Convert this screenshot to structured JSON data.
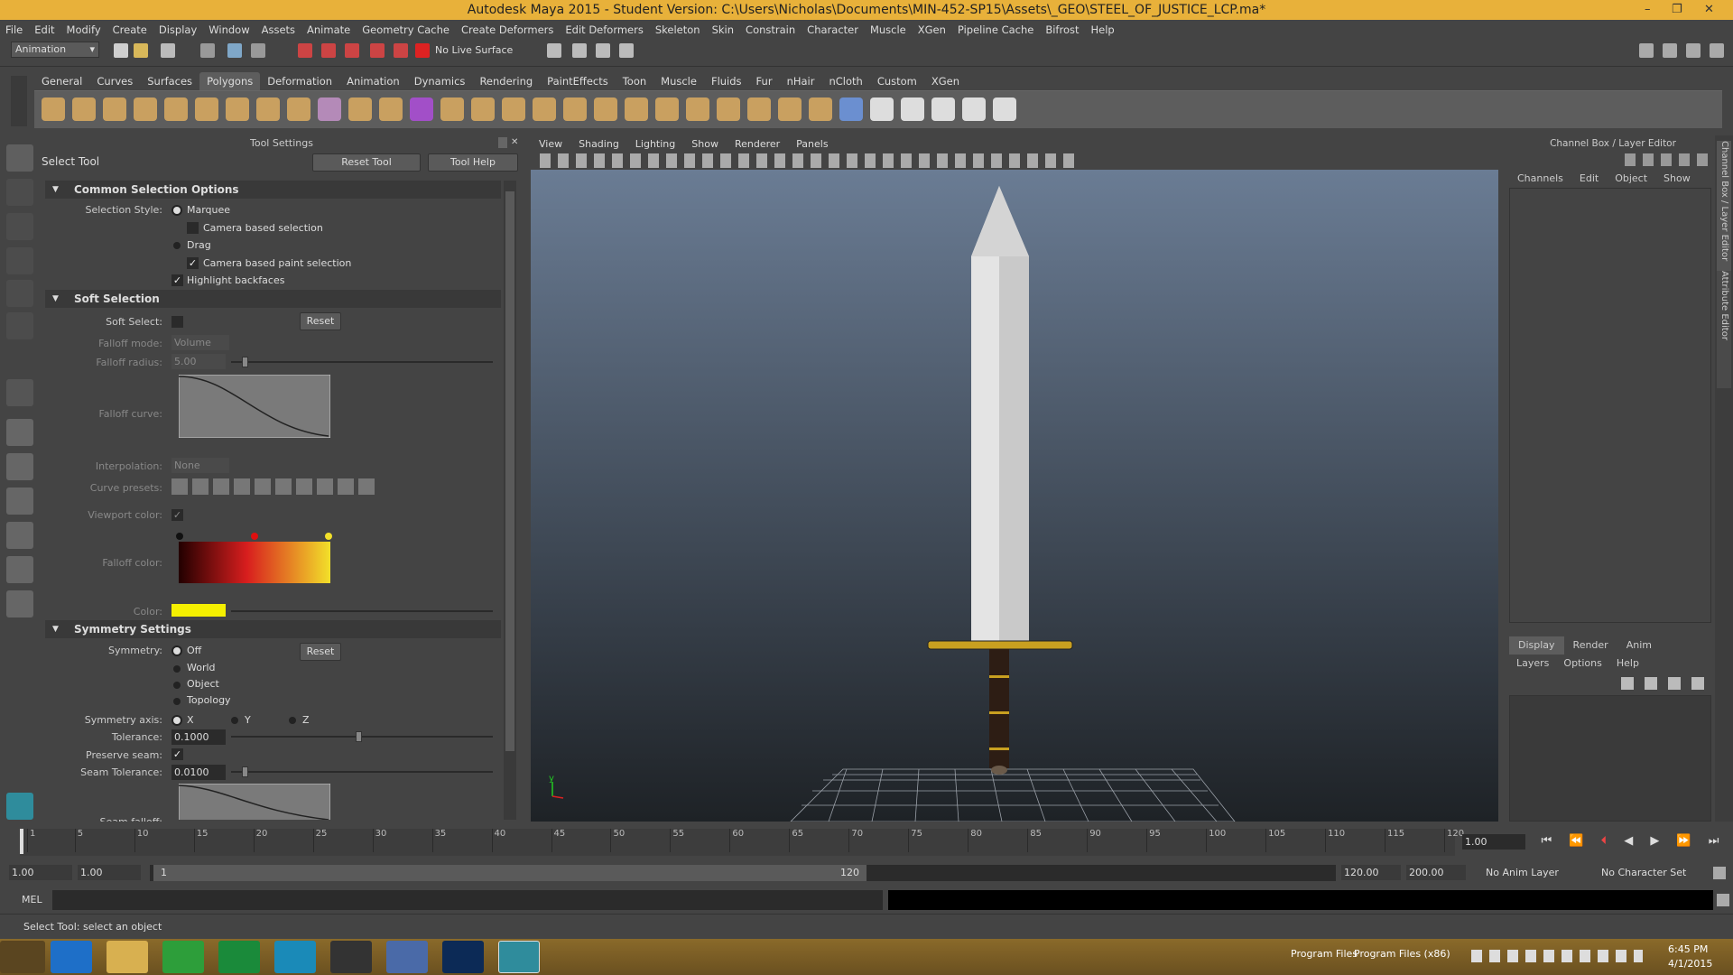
{
  "titlebar": {
    "title": "Autodesk Maya 2015 - Student Version: C:\\Users\\Nicholas\\Documents\\MIN-452-SP15\\Assets\\_GEO\\STEEL_OF_JUSTICE_LCP.ma*",
    "minimize": "–",
    "restore": "❐",
    "close": "✕"
  },
  "menubar": [
    "File",
    "Edit",
    "Modify",
    "Create",
    "Display",
    "Window",
    "Assets",
    "Animate",
    "Geometry Cache",
    "Create Deformers",
    "Edit Deformers",
    "Skeleton",
    "Skin",
    "Constrain",
    "Character",
    "Muscle",
    "XGen",
    "Pipeline Cache",
    "Bifrost",
    "Help"
  ],
  "statusline": {
    "mode": "Animation",
    "live_surface": "No Live Surface"
  },
  "shelf": {
    "tabs": [
      "General",
      "Curves",
      "Surfaces",
      "Polygons",
      "Deformation",
      "Animation",
      "Dynamics",
      "Rendering",
      "PaintEffects",
      "Toon",
      "Muscle",
      "Fluids",
      "Fur",
      "nHair",
      "nCloth",
      "Custom",
      "XGen"
    ],
    "active": "Polygons"
  },
  "tool_settings": {
    "header": "Tool Settings",
    "tool_name": "Select Tool",
    "reset_button": "Reset Tool",
    "help_button": "Tool Help",
    "common": {
      "title": "Common Selection Options",
      "style_label": "Selection Style:",
      "marquee": "Marquee",
      "camera_based": "Camera based selection",
      "drag": "Drag",
      "camera_paint": "Camera based paint selection",
      "backfaces": "Highlight backfaces"
    },
    "soft": {
      "title": "Soft Selection",
      "soft_select": "Soft Select:",
      "reset": "Reset",
      "falloff_mode": "Falloff mode:",
      "falloff_mode_val": "Volume",
      "falloff_radius": "Falloff radius:",
      "falloff_radius_val": "5.00",
      "falloff_curve": "Falloff curve:",
      "interpolation": "Interpolation:",
      "interpolation_val": "None",
      "curve_presets": "Curve presets:",
      "viewport_color": "Viewport color:",
      "falloff_color": "Falloff color:",
      "color": "Color:"
    },
    "symmetry": {
      "title": "Symmetry Settings",
      "symmetry": "Symmetry:",
      "off": "Off",
      "world": "World",
      "object": "Object",
      "topology": "Topology",
      "reset": "Reset",
      "axis": "Symmetry axis:",
      "x": "X",
      "y": "Y",
      "z": "Z",
      "tolerance": "Tolerance:",
      "tolerance_val": "0.1000",
      "preserve": "Preserve seam:",
      "seam_tol": "Seam Tolerance:",
      "seam_tol_val": "0.0100",
      "seam_falloff": "Seam falloff:"
    }
  },
  "viewport": {
    "menu": [
      "View",
      "Shading",
      "Lighting",
      "Show",
      "Renderer",
      "Panels"
    ],
    "axis_y": "y"
  },
  "channel_box": {
    "header": "Channel Box / Layer Editor",
    "menu": [
      "Channels",
      "Edit",
      "Object",
      "Show"
    ],
    "layer_tabs": [
      "Display",
      "Render",
      "Anim"
    ],
    "layer_menu": [
      "Layers",
      "Options",
      "Help"
    ],
    "side_tabs": [
      "Channel Box / Layer Editor",
      "Attribute Editor"
    ]
  },
  "timeline": {
    "ticks": [
      "1",
      "5",
      "10",
      "15",
      "20",
      "25",
      "30",
      "35",
      "40",
      "45",
      "50",
      "55",
      "60",
      "65",
      "70",
      "75",
      "80",
      "85",
      "90",
      "95",
      "100",
      "105",
      "110",
      "115",
      "120"
    ],
    "current_frame": "1.00"
  },
  "range": {
    "start": "1.00",
    "start2": "1.00",
    "range_start": "1",
    "range_end": "120",
    "end": "120.00",
    "end2": "200.00",
    "anim_layer": "No Anim Layer",
    "char_set": "No Character Set"
  },
  "cmdline": {
    "label": "MEL"
  },
  "helpline": {
    "text": "Select Tool: select an object"
  },
  "taskbar": {
    "tray1": "Program Files",
    "tray2": "Program Files (x86)",
    "time": "6:45 PM",
    "date": "4/1/2015"
  }
}
